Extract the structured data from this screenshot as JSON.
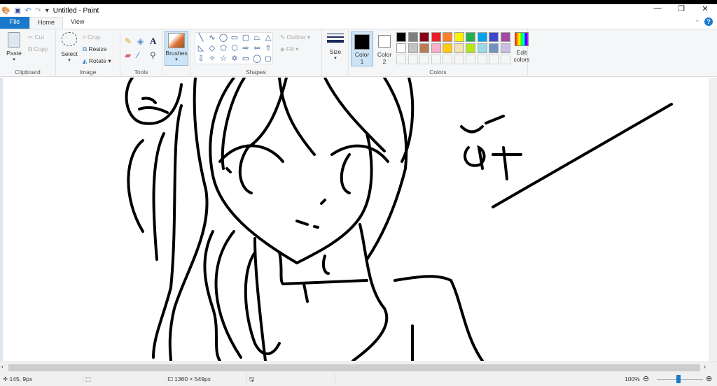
{
  "window": {
    "title": "Untitled - Paint",
    "minimize": "—",
    "restore": "❐",
    "close": "✕"
  },
  "tabs": {
    "file": "File",
    "home": "Home",
    "view": "View"
  },
  "help": {
    "collapse": "^",
    "help": "?"
  },
  "clipboard": {
    "paste": "Paste",
    "cut": "Cut",
    "copy": "Copy",
    "label": "Clipboard"
  },
  "image": {
    "select": "Select",
    "crop": "Crop",
    "resize": "Resize",
    "rotate": "Rotate",
    "label": "Image"
  },
  "tools": {
    "label": "Tools",
    "text": "A"
  },
  "brushes": {
    "label": "Brushes"
  },
  "shapes": {
    "outline": "Outline",
    "fill": "Fill",
    "label": "Shapes",
    "glyphs": [
      "╲",
      "∿",
      "◯",
      "▭",
      "▢",
      "⏢",
      "△",
      "◺",
      "◇",
      "⬠",
      "⬡",
      "⇨",
      "⇦",
      "⇧",
      "⇩",
      "✧",
      "☆",
      "✡",
      "▭",
      "◯",
      "◻"
    ]
  },
  "size": {
    "label": "Size"
  },
  "colors": {
    "color1": "Color",
    "color1_num": "1",
    "color2": "Color",
    "color2_num": "2",
    "edit": "Edit",
    "edit2": "colors",
    "label": "Colors",
    "row1": [
      "#000000",
      "#7f7f7f",
      "#880015",
      "#ed1c24",
      "#ff7f27",
      "#fff200",
      "#22b14c",
      "#00a2e8",
      "#3f48cc",
      "#a349a4"
    ],
    "row2": [
      "#ffffff",
      "#c3c3c3",
      "#b97a57",
      "#ffaec9",
      "#ffc90e",
      "#efe4b0",
      "#b5e61d",
      "#99d9ea",
      "#7092be",
      "#c8bfe7"
    ]
  },
  "status": {
    "position": "145, 9px",
    "size": "1360 × 549px",
    "zoom": "100%"
  },
  "canvas": {
    "text": "ăt"
  }
}
